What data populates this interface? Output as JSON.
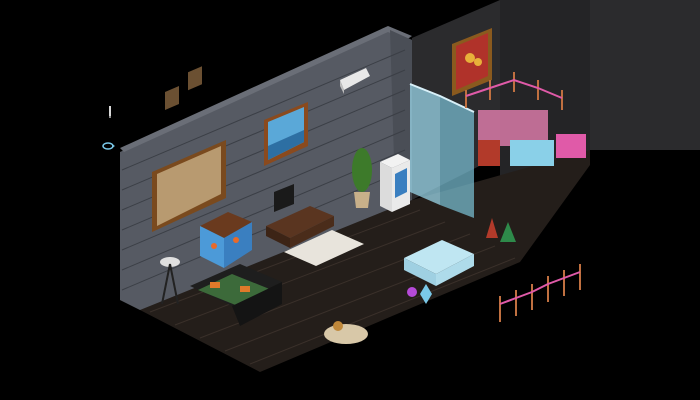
{
  "room": {
    "name": "",
    "floor_color": "#241e1a",
    "floor_line": "#3a302a",
    "brick_color": "#565a63",
    "brick_line": "#3b3f46",
    "brick_top": "#6a6e77",
    "back_wall": "#2b2b2d",
    "accent_pink": "#e05aa8",
    "accent_red": "#b23a2a"
  },
  "hud": {
    "icons": [
      "pencil-icon",
      "rotate-icon"
    ]
  },
  "items": [
    "large-painting",
    "seascape-painting",
    "air-conditioner",
    "sunflower-painting",
    "glass-door",
    "aquarium",
    "television",
    "potted-plant",
    "vending-machine",
    "white-rug",
    "coffee-table",
    "sofa-set",
    "floor-lamp",
    "ice-sofa",
    "christmas-decorations",
    "bollard-rope-set",
    "round-rug-with-pet",
    "crystal-orbs",
    "gift-boxes"
  ]
}
